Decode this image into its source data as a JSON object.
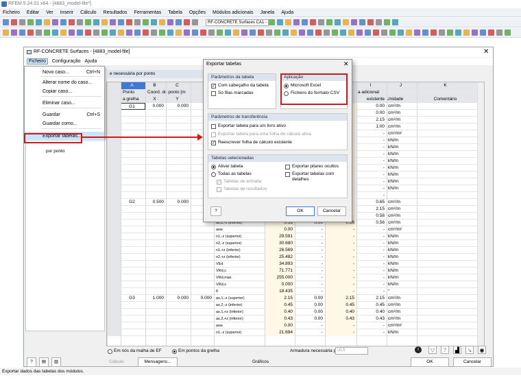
{
  "app": {
    "title": "RFEM 5.24.01 x64 - [4883_model-file*]",
    "status": "Exportar dados das tabelas dos módulos."
  },
  "menubar": [
    "Ficheiro",
    "Editar",
    "Ver",
    "Inserir",
    "Cálculo",
    "Resultados",
    "Ferramentas",
    "Tabela",
    "Opções",
    "Módulos adicionais",
    "Janela",
    "Ajuda"
  ],
  "toolbar": {
    "module_combo": "RF-CONCRETE Surfaces CA1 - Dimensio"
  },
  "module": {
    "title": "RF-CONCRETE Surfaces - [4883_model-file]",
    "menu": [
      "Ficheiro",
      "Configuração",
      "Ajuda"
    ],
    "tree_item": "por ponto",
    "table_title": "e necessária por ponto"
  },
  "file_menu": [
    {
      "label": "Novo caso...",
      "shortcut": "Ctrl+N"
    },
    {
      "label": "Alterar nome do caso...",
      "shortcut": ""
    },
    {
      "label": "Copiar caso...",
      "shortcut": ""
    },
    {
      "label": "Eliminar caso...",
      "shortcut": ""
    },
    {
      "label": "Guardar",
      "shortcut": "Ctrl+S"
    },
    {
      "label": "Guardar como...",
      "shortcut": ""
    },
    {
      "label": "Exportar tabelas...",
      "shortcut": ""
    }
  ],
  "table": {
    "letters": [
      "A",
      "B",
      "C",
      "I",
      "J",
      "K"
    ],
    "h_ponto": "Ponto",
    "h_grelha": "a grelha",
    "h_coord": "Coord. do ponto [m",
    "h_x": "X",
    "h_y": "Y",
    "h_adic": "a adicional",
    "h_exist": "existente",
    "h_unid": "Unidade",
    "h_com": "Comentário",
    "rows": [
      {
        "g": "G1",
        "x": "0.000",
        "y": "0.000",
        "t": "",
        "v1": "",
        "v2": "",
        "v3": "",
        "e": "0.00",
        "u": "cm²/m"
      },
      {
        "g": "",
        "x": "",
        "y": "",
        "t": "",
        "v1": "",
        "v2": "",
        "v3": "",
        "e": "0.00",
        "u": "cm²/m"
      },
      {
        "g": "",
        "x": "",
        "y": "",
        "t": "",
        "v1": "",
        "v2": "",
        "v3": "",
        "e": "2.15",
        "u": "cm²/m"
      },
      {
        "g": "",
        "x": "",
        "y": "",
        "t": "",
        "v1": "",
        "v2": "",
        "v3": "",
        "e": "1.00",
        "u": "cm²/m"
      },
      {
        "g": "",
        "x": "",
        "y": "",
        "t": "",
        "v1": "",
        "v2": "",
        "v3": "",
        "e": "-",
        "u": "cm²/m²"
      },
      {
        "g": "",
        "x": "",
        "y": "",
        "t": "",
        "v1": "",
        "v2": "",
        "v3": "",
        "e": "-",
        "u": "kN/m"
      },
      {
        "g": "",
        "x": "",
        "y": "",
        "t": "",
        "v1": "",
        "v2": "",
        "v3": "",
        "e": "-",
        "u": "kN/m"
      },
      {
        "g": "",
        "x": "",
        "y": "",
        "t": "",
        "v1": "",
        "v2": "",
        "v3": "",
        "e": "-",
        "u": "kN/m"
      },
      {
        "g": "",
        "x": "",
        "y": "",
        "t": "",
        "v1": "",
        "v2": "",
        "v3": "",
        "e": "-",
        "u": "kN/m"
      },
      {
        "g": "",
        "x": "",
        "y": "",
        "t": "",
        "v1": "",
        "v2": "",
        "v3": "",
        "e": "-",
        "u": "kN/m"
      },
      {
        "g": "",
        "x": "",
        "y": "",
        "t": "",
        "v1": "",
        "v2": "",
        "v3": "",
        "e": "-",
        "u": "kN/m"
      },
      {
        "g": "",
        "x": "",
        "y": "",
        "t": "",
        "v1": "",
        "v2": "",
        "v3": "",
        "e": "-",
        "u": "kN/m"
      },
      {
        "g": "",
        "x": "",
        "y": "",
        "t": "",
        "v1": "",
        "v2": "",
        "v3": "",
        "e": "-",
        "u": "kN/m"
      },
      {
        "g": "",
        "x": "",
        "y": "",
        "t": "",
        "v1": "",
        "v2": "",
        "v3": "",
        "e": "-",
        "u": ""
      },
      {
        "g": "G2",
        "x": "0.500",
        "y": "0.000",
        "t": "",
        "v1": "",
        "v2": "",
        "v3": "",
        "e": "0.65",
        "u": "cm²/m"
      },
      {
        "g": "",
        "x": "",
        "y": "",
        "t": "",
        "v1": "",
        "v2": "",
        "v3": "",
        "e": "2.15",
        "u": "cm²/m"
      },
      {
        "g": "",
        "x": "",
        "y": "",
        "t": "",
        "v1": "",
        "v2": "",
        "v3": "",
        "e": "0.58",
        "u": "cm²/m"
      },
      {
        "g": "",
        "x": "",
        "y": "",
        "t": "as,2,-z (inferior)",
        "v1": "0.56",
        "v2": "0.00",
        "v3": "0.56",
        "e": "0.56",
        "u": "cm²/m"
      },
      {
        "g": "",
        "x": "",
        "y": "",
        "t": "asw",
        "v1": "0.00",
        "v2": "-",
        "v3": "-",
        "e": "-",
        "u": "cm²/m²"
      },
      {
        "g": "",
        "x": "",
        "y": "",
        "t": "n1,-z (superior)",
        "v1": "29.591",
        "v2": "-",
        "v3": "-",
        "e": "-",
        "u": "kN/m"
      },
      {
        "g": "",
        "x": "",
        "y": "",
        "t": "n2,-z (superior)",
        "v1": "30.680",
        "v2": "-",
        "v3": "-",
        "e": "-",
        "u": "kN/m"
      },
      {
        "g": "",
        "x": "",
        "y": "",
        "t": "n1,+z (inferior)",
        "v1": "26.569",
        "v2": "-",
        "v3": "-",
        "e": "-",
        "u": "kN/m"
      },
      {
        "g": "",
        "x": "",
        "y": "",
        "t": "n2,+z (inferior)",
        "v1": "25.482",
        "v2": "-",
        "v3": "-",
        "e": "-",
        "u": "kN/m"
      },
      {
        "g": "",
        "x": "",
        "y": "",
        "t": "VEd",
        "v1": "34.893",
        "v2": "-",
        "v3": "-",
        "e": "-",
        "u": "kN/m"
      },
      {
        "g": "",
        "x": "",
        "y": "",
        "t": "VRd,c",
        "v1": "71.771",
        "v2": "-",
        "v3": "-",
        "e": "-",
        "u": "kN/m"
      },
      {
        "g": "",
        "x": "",
        "y": "",
        "t": "VRd,max",
        "v1": "255.000",
        "v2": "-",
        "v3": "-",
        "e": "-",
        "u": "kN/m"
      },
      {
        "g": "",
        "x": "",
        "y": "",
        "t": "VRd,s",
        "v1": "0.000",
        "v2": "-",
        "v3": "-",
        "e": "-",
        "u": "kN/m"
      },
      {
        "g": "",
        "x": "",
        "y": "",
        "t": "θ",
        "v1": "18.435",
        "v2": "-",
        "v3": "-",
        "e": "-",
        "u": "°"
      },
      {
        "g": "G3",
        "x": "1.000",
        "y": "0.000",
        "z": "0.000",
        "t": "as,1,-z (superior)",
        "v1": "2.15",
        "v2": "0.00",
        "v3": "2.15",
        "e": "2.15",
        "u": "cm²/m"
      },
      {
        "g": "",
        "x": "",
        "y": "",
        "t": "as,2,-z (inferior)",
        "v1": "0.45",
        "v2": "0.00",
        "v3": "0.45",
        "e": "0.45",
        "u": "cm²/m"
      },
      {
        "g": "",
        "x": "",
        "y": "",
        "t": "as,1,+z (inferior)",
        "v1": "0.40",
        "v2": "0.00",
        "v3": "0.40",
        "e": "0.40",
        "u": "cm²/m"
      },
      {
        "g": "",
        "x": "",
        "y": "",
        "t": "as,2,+z (inferior)",
        "v1": "0.43",
        "v2": "0.00",
        "v3": "0.43",
        "e": "0.43",
        "u": "cm²/m"
      },
      {
        "g": "",
        "x": "",
        "y": "",
        "t": "asw",
        "v1": "0.00",
        "v2": "-",
        "v3": "-",
        "e": "-",
        "u": "cm²/m²"
      },
      {
        "g": "",
        "x": "",
        "y": "",
        "t": "n1,-z (superior)",
        "v1": "21.694",
        "v2": "-",
        "v3": "-",
        "e": "-",
        "u": "kN/m"
      }
    ]
  },
  "bottom": {
    "radio1": "Em nós da malha de EF",
    "radio2": "Em pontos da grelha",
    "armadura_label": "Armadura necessária para:",
    "armadura_value": "ULS"
  },
  "footer": {
    "calc": "Cálculo",
    "msg": "Mensagens...",
    "graf": "Gráficos",
    "ok": "OK",
    "cancel": "Cancelar"
  },
  "dialog": {
    "title": "Exportar tabelas",
    "g1": "Parâmetros da tabela",
    "g1a": "Com cabeçalho da tabela",
    "g1b": "Só filas marcadas",
    "g2": "Aplicação",
    "g2a": "Microsoft Excel",
    "g2b": "Ficheiro do formato CSV",
    "g3": "Parâmetros de transferência",
    "g3a": "Exportar tabela para um livro ativo",
    "g3b": "Exportar tabela para uma folha de cálculo ativa",
    "g3c": "Reescrever folha de cálculo existente",
    "g4": "Tabelas selecionadas",
    "g4a": "Ativar tabela",
    "g4b": "Todas as tabelas",
    "g4c": "Tabelas de entrada",
    "g4d": "Tabelas de resultados",
    "g4e": "Exportar pilares ocultos",
    "g4f": "Exportar tabelas com detalhes",
    "ok": "OK",
    "cancel": "Cancelar"
  }
}
